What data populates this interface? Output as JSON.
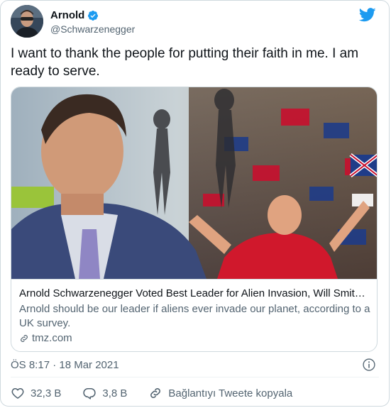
{
  "tweet": {
    "author_name": "Arnold",
    "author_handle": "@Schwarzenegger",
    "text": "I want to thank the people for putting their faith in me. I am ready to serve.",
    "timestamp": "ÖS 8:17 · 18 Mar 2021"
  },
  "card": {
    "title": "Arnold Schwarzenegger Voted Best Leader for Alien Invasion, Will Smith ...",
    "description": "Arnold should be our leader if aliens ever invade our planet, according to a UK survey.",
    "domain": "tmz.com"
  },
  "actions": {
    "likes": "32,3 B",
    "replies": "3,8 B",
    "copy_link": "Bağlantıyı Tweete kopyala"
  },
  "icons": {
    "verified": "verified-badge-icon",
    "twitter": "twitter-bird-icon",
    "link": "link-icon",
    "info": "info-icon",
    "like": "heart-icon",
    "reply": "reply-icon",
    "copy": "link-icon"
  },
  "colors": {
    "twitter_blue": "#1d9bf0",
    "text_primary": "#0f1419",
    "text_secondary": "#536471",
    "border": "#cfd9de"
  }
}
